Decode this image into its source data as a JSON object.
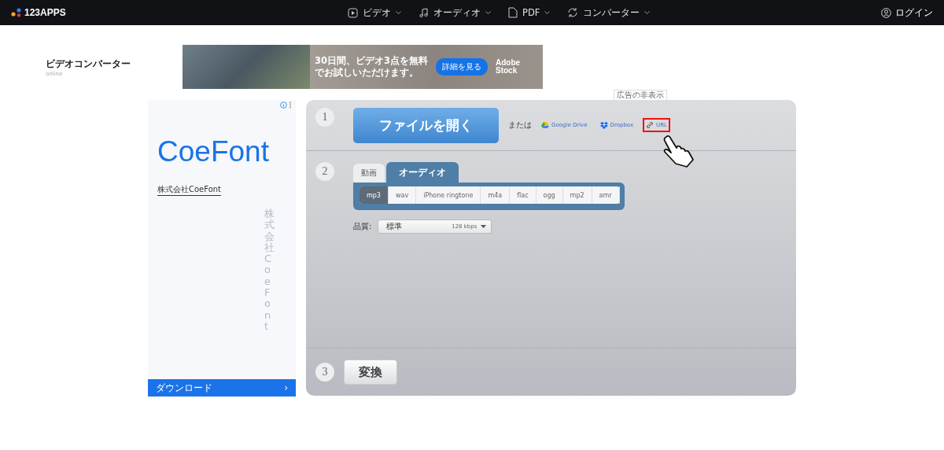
{
  "header": {
    "logo": "123APPS",
    "nav": [
      {
        "label": "ビデオ",
        "kind": "play"
      },
      {
        "label": "オーディオ",
        "kind": "note"
      },
      {
        "label": "PDF",
        "kind": "doc"
      },
      {
        "label": "コンバーター",
        "kind": "cycle"
      }
    ],
    "login": "ログイン"
  },
  "page_title": "ビデオコンバーター",
  "page_subtitle": "online",
  "banner_ad": {
    "text": "30日間、ビデオ3点を無料でお試しいただけます。",
    "button": "詳細を見る",
    "brand_line_1": "Adobe",
    "brand_line_2": "Stock"
  },
  "hide_ads": "広告の非表示",
  "side_ad": {
    "brand": "CoeFont",
    "company": "株式会社CoeFont",
    "watermark": "株式会社CoeFont",
    "download": "ダウンロード",
    "chevron": "›"
  },
  "steps": {
    "step_1": "1",
    "open_file": "ファイルを開く",
    "or": "または",
    "sources": [
      {
        "label": "Google Drive",
        "kind": "drive",
        "highlighted": false
      },
      {
        "label": "Dropbox",
        "kind": "dropbox",
        "highlighted": false
      },
      {
        "label": "URL",
        "kind": "link",
        "highlighted": true
      }
    ],
    "step_2": "2",
    "tabs": [
      {
        "label": "動画",
        "selected": false
      },
      {
        "label": "オーディオ",
        "selected": true
      }
    ],
    "formats": [
      {
        "label": "mp3",
        "selected": true
      },
      {
        "label": "wav",
        "selected": false
      },
      {
        "label": "iPhone ringtone",
        "selected": false
      },
      {
        "label": "m4a",
        "selected": false
      },
      {
        "label": "flac",
        "selected": false
      },
      {
        "label": "ogg",
        "selected": false
      },
      {
        "label": "mp2",
        "selected": false
      },
      {
        "label": "amr",
        "selected": false
      }
    ],
    "quality_label": "品質:",
    "quality_value": "標準",
    "quality_rate": "128 kbps",
    "step_3": "3",
    "convert": "変換"
  }
}
